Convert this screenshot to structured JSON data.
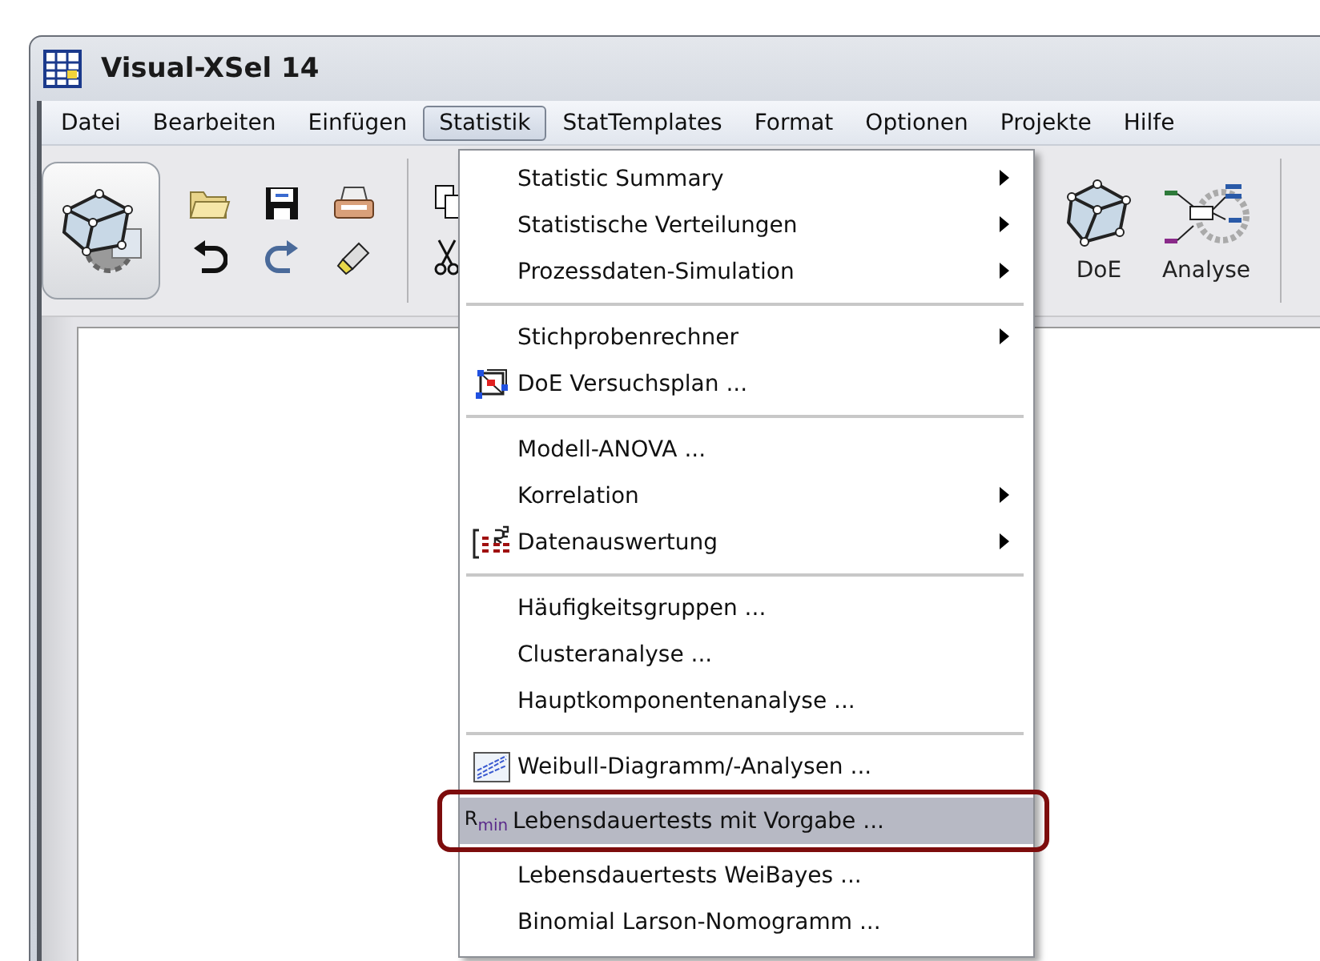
{
  "window": {
    "title": "Visual-XSel 14"
  },
  "menu_bar": [
    {
      "label": "Datei",
      "selected": false
    },
    {
      "label": "Bearbeiten",
      "selected": false
    },
    {
      "label": "Einfügen",
      "selected": false
    },
    {
      "label": "Statistik",
      "selected": true
    },
    {
      "label": "StatTemplates",
      "selected": false
    },
    {
      "label": "Format",
      "selected": false
    },
    {
      "label": "Optionen",
      "selected": false
    },
    {
      "label": "Projekte",
      "selected": false
    },
    {
      "label": "Hilfe",
      "selected": false
    }
  ],
  "toolbar": {
    "buttons": [
      {
        "label": "DoE",
        "kind": "doe"
      },
      {
        "label": "Analyse",
        "kind": "analyse"
      }
    ]
  },
  "dropdown": {
    "sections": [
      [
        {
          "label": "Statistic Summary",
          "kind": "plain",
          "submenu": true,
          "selected": false
        },
        {
          "label": "Statistische Verteilungen",
          "kind": "plain",
          "submenu": true,
          "selected": false
        },
        {
          "label": "Prozessdaten-Simulation",
          "kind": "plain",
          "submenu": true,
          "selected": false
        }
      ],
      [
        {
          "label": "Stichprobenrechner",
          "kind": "plain",
          "submenu": true,
          "selected": false
        },
        {
          "label": "DoE Versuchsplan ...",
          "kind": "cube",
          "submenu": false,
          "selected": false
        }
      ],
      [
        {
          "label": "Modell-ANOVA ...",
          "kind": "plain",
          "submenu": false,
          "selected": false
        },
        {
          "label": "Korrelation",
          "kind": "plain",
          "submenu": true,
          "selected": false
        },
        {
          "label": "Datenauswertung",
          "kind": "table",
          "submenu": true,
          "selected": false
        }
      ],
      [
        {
          "label": "Häufigkeitsgruppen ...",
          "kind": "plain",
          "submenu": false,
          "selected": false
        },
        {
          "label": "Clusteranalyse ...",
          "kind": "plain",
          "submenu": false,
          "selected": false
        },
        {
          "label": "Hauptkomponentenanalyse ...",
          "kind": "plain",
          "submenu": false,
          "selected": false
        }
      ],
      [
        {
          "label": "Weibull-Diagramm/-Analysen ...",
          "kind": "chart",
          "submenu": false,
          "selected": false
        },
        {
          "label": "Lebensdauertests mit Vorgabe ...",
          "kind": "labelled",
          "icon_label": "R$_{min}$",
          "submenu": false,
          "selected": true
        },
        {
          "label": "Lebensdauertests WeiBayes ...",
          "kind": "plain",
          "submenu": false,
          "selected": false
        },
        {
          "label": "Binomial Larson-Nomogramm ...",
          "kind": "plain",
          "submenu": false,
          "selected": false
        }
      ]
    ]
  }
}
